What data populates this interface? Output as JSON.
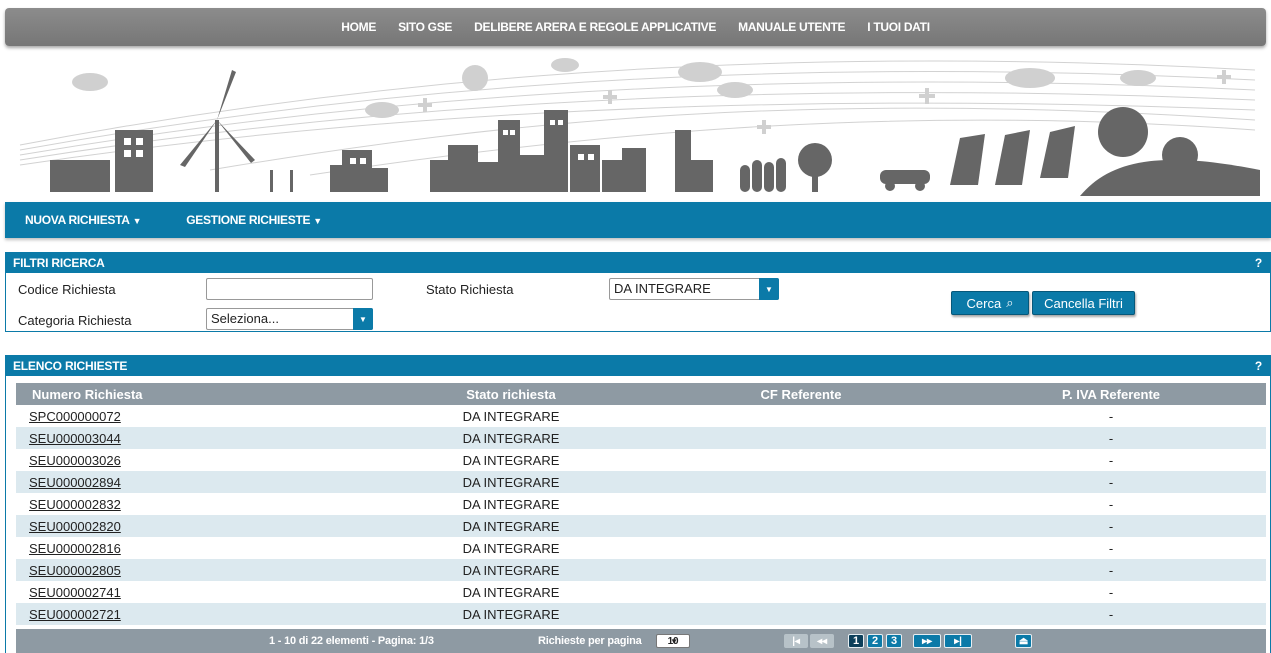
{
  "nav": {
    "items": [
      "HOME",
      "SITO GSE",
      "DELIBERE ARERA E REGOLE APPLICATIVE",
      "MANUALE UTENTE",
      "I TUOI DATI"
    ]
  },
  "menubar": {
    "nuova": "NUOVA RICHIESTA",
    "gestione": "GESTIONE RICHIESTE"
  },
  "filters": {
    "title": "FILTRI RICERCA",
    "help": "?",
    "codice_label": "Codice Richiesta",
    "codice_value": "",
    "categoria_label": "Categoria Richiesta",
    "categoria_value": "Seleziona...",
    "stato_label": "Stato Richiesta",
    "stato_value": "DA INTEGRARE",
    "cerca": "Cerca",
    "cancella": "Cancella Filtri"
  },
  "list": {
    "title": "ELENCO RICHIESTE",
    "help": "?",
    "columns": [
      "Numero Richiesta",
      "Stato richiesta",
      "CF Referente",
      "P. IVA Referente"
    ],
    "rows": [
      {
        "numero": "SPC000000072",
        "stato": "DA INTEGRARE",
        "cf": "",
        "piva": "-"
      },
      {
        "numero": "SEU000003044",
        "stato": "DA INTEGRARE",
        "cf": "",
        "piva": "-"
      },
      {
        "numero": "SEU000003026",
        "stato": "DA INTEGRARE",
        "cf": "",
        "piva": "-"
      },
      {
        "numero": "SEU000002894",
        "stato": "DA INTEGRARE",
        "cf": "",
        "piva": "-"
      },
      {
        "numero": "SEU000002832",
        "stato": "DA INTEGRARE",
        "cf": "",
        "piva": "-"
      },
      {
        "numero": "SEU000002820",
        "stato": "DA INTEGRARE",
        "cf": "",
        "piva": "-"
      },
      {
        "numero": "SEU000002816",
        "stato": "DA INTEGRARE",
        "cf": "",
        "piva": "-"
      },
      {
        "numero": "SEU000002805",
        "stato": "DA INTEGRARE",
        "cf": "",
        "piva": "-"
      },
      {
        "numero": "SEU000002741",
        "stato": "DA INTEGRARE",
        "cf": "",
        "piva": "-"
      },
      {
        "numero": "SEU000002721",
        "stato": "DA INTEGRARE",
        "cf": "",
        "piva": "-"
      }
    ],
    "pager": {
      "summary": "1 - 10 di 22 elementi - Pagina: 1/3",
      "per_page_label": "Richieste per pagina",
      "per_page_value": "10",
      "pages": [
        "1",
        "2",
        "3"
      ]
    }
  },
  "colors": {
    "primary": "#0b7aa8",
    "nav_gray": "#808080",
    "header_gray": "#8e9aa3",
    "row_alt": "#dce9ef"
  },
  "icons": [
    "search-icon",
    "chevron-down-icon",
    "first-page-icon",
    "prev-page-icon",
    "next-page-icon",
    "last-page-icon",
    "scroll-top-icon"
  ]
}
